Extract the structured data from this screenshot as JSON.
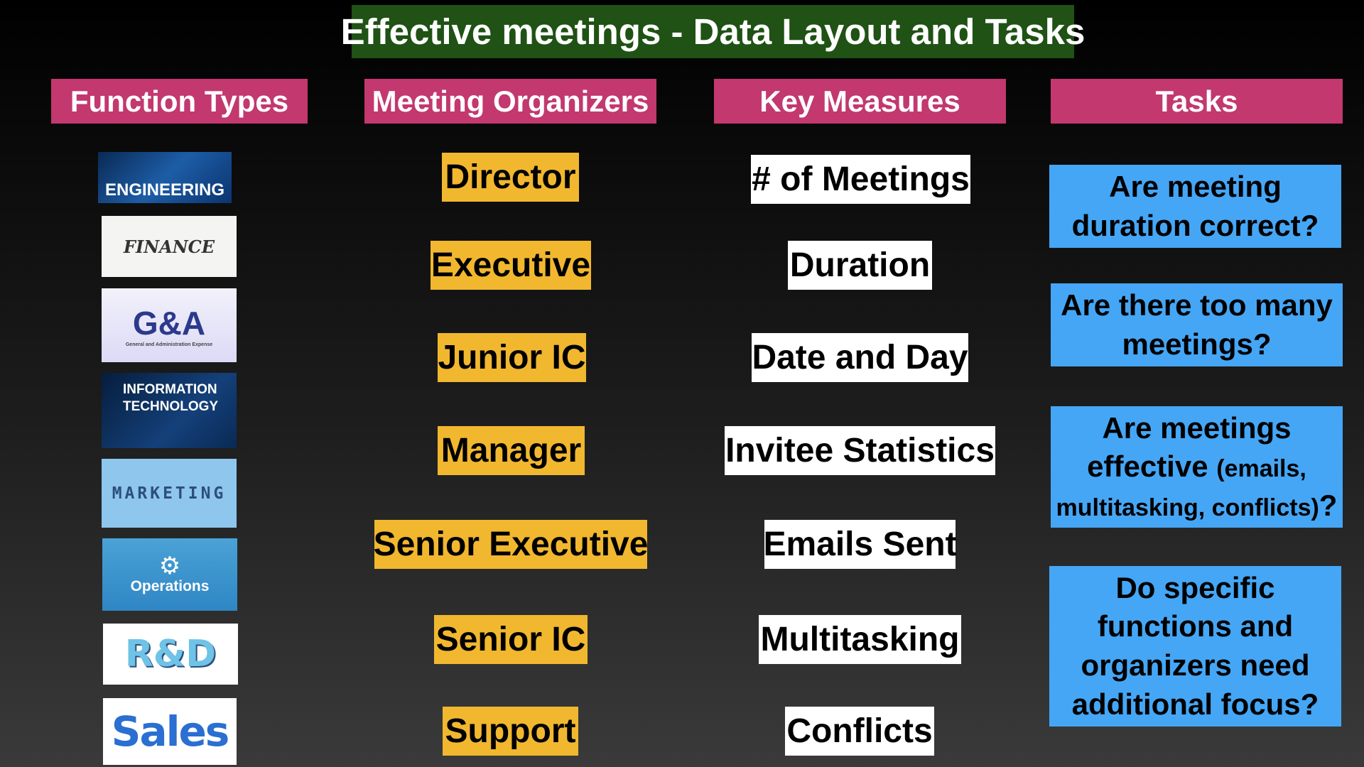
{
  "title": "Effective meetings - Data Layout and Tasks",
  "headers": {
    "function_types": "Function Types",
    "meeting_organizers": "Meeting Organizers",
    "key_measures": "Key Measures",
    "tasks": "Tasks"
  },
  "function_types": [
    {
      "label": "ENGINEERING",
      "icon": "engineering-image"
    },
    {
      "label": "FINANCE",
      "icon": "finance-image"
    },
    {
      "label": "G&A",
      "sublabel": "General and Administration Expense",
      "icon": "ga-image"
    },
    {
      "label": "INFORMATION TECHNOLOGY",
      "icon": "it-image"
    },
    {
      "label": "MARKETING",
      "icon": "marketing-image"
    },
    {
      "label": "Operations",
      "icon": "operations-image"
    },
    {
      "label": "R&D",
      "icon": "rd-image"
    },
    {
      "label": "Sales",
      "icon": "sales-image"
    }
  ],
  "organizers": [
    "Director",
    "Executive",
    "Junior IC",
    "Manager",
    "Senior Executive",
    "Senior IC",
    "Support"
  ],
  "measures": [
    "# of Meetings",
    "Duration",
    "Date and Day",
    "Invitee Statistics",
    "Emails Sent",
    "Multitasking",
    "Conflicts"
  ],
  "tasks": [
    {
      "text": "Are meeting duration correct?"
    },
    {
      "text": "Are there too many meetings?"
    },
    {
      "text": "Are meetings effective",
      "small": "(emails, multitasking, conflicts)",
      "suffix": "?"
    },
    {
      "text": "Do specific functions and organizers need additional focus?"
    }
  ],
  "colors": {
    "title_bg": "#1f5214",
    "header_bg": "#c2386f",
    "organizer_bg": "#f1b72f",
    "measure_bg": "#ffffff",
    "task_bg": "#45a6f5"
  }
}
